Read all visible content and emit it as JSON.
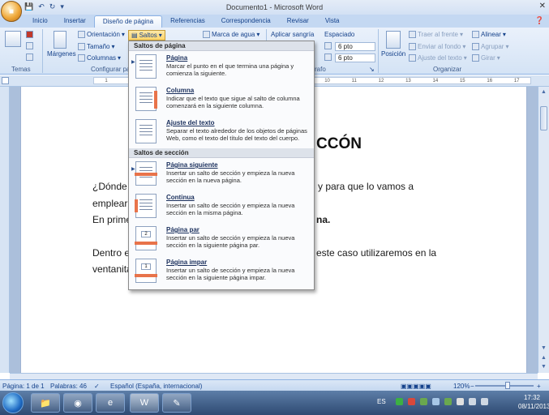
{
  "window": {
    "title": "Documento1 - Microsoft Word"
  },
  "tabs": [
    "Inicio",
    "Insertar",
    "Diseño de página",
    "Referencias",
    "Correspondencia",
    "Revisar",
    "Vista"
  ],
  "active_tab": "Diseño de página",
  "ribbon": {
    "temas_label": "Temas",
    "margenes": "Márgenes",
    "orientacion": "Orientación",
    "tamano": "Tamaño",
    "columnas": "Columnas",
    "saltos": "Saltos",
    "configurar_pagina_label": "Configurar pá",
    "marca_agua": "Marca de agua",
    "aplicar_sangria": "Aplicar sangría",
    "espaciado": "Espaciado",
    "esp_antes": "6 pto",
    "esp_despues": "6 pto",
    "parrafo_label": "rafo",
    "posicion": "Posición",
    "traer_frente": "Traer al frente",
    "enviar_fondo": "Enviar al fondo",
    "ajuste_texto": "Ajuste del texto",
    "alinear": "Alinear",
    "agrupar": "Agrupar",
    "girar": "Girar",
    "organizar_label": "Organizar"
  },
  "ruler": {
    "ticks": [
      "1",
      "2",
      "3",
      "4",
      "5",
      "6",
      "7",
      "8",
      "9",
      "10",
      "11",
      "12",
      "13",
      "14",
      "15",
      "16",
      "17"
    ]
  },
  "document": {
    "title": "CCÓN",
    "lines": [
      {
        "left": "¿Dónde",
        "right": "y para que lo vamos a"
      },
      {
        "left": "emplear",
        "right": ""
      },
      {
        "left": "En prime",
        "right": "na."
      },
      {
        "left": "Dentro e",
        "right": "este caso utilizaremos en la"
      },
      {
        "left": "ventanita",
        "right": ""
      }
    ]
  },
  "menu": {
    "header_pagina": "Saltos de página",
    "header_seccion": "Saltos de sección",
    "items_pagina": [
      {
        "title": "Página",
        "desc": "Marcar el punto en el que termina una página y comienza la siguiente."
      },
      {
        "title": "Columna",
        "desc": "Indicar que el texto que sigue al salto de columna comenzará en la siguiente columna."
      },
      {
        "title": "Ajuste del texto",
        "desc": "Separar el texto alrededor de los objetos de páginas Web, como el texto del título del texto del cuerpo."
      }
    ],
    "items_seccion": [
      {
        "title": "Página siguiente",
        "desc": "Insertar un salto de sección y empieza la nueva sección en la nueva página."
      },
      {
        "title": "Continua",
        "desc": "Insertar un salto de sección y empieza la nueva sección en la misma página."
      },
      {
        "title": "Página par",
        "desc": "Insertar un salto de sección y empieza la nueva sección en la siguiente página par."
      },
      {
        "title": "Página impar",
        "desc": "Insertar un salto de sección y empieza la nueva sección en la siguiente página impar."
      }
    ]
  },
  "status": {
    "pagina": "Página: 1 de 1",
    "palabras": "Palabras: 46",
    "idioma": "Español (España, internacional)",
    "zoom": "120%"
  },
  "taskbar": {
    "lang": "ES",
    "time": "17:32",
    "date": "08/11/2013"
  }
}
